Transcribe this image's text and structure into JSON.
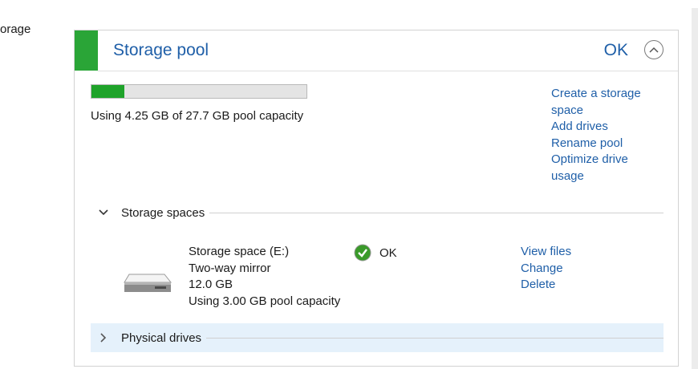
{
  "left_crumb": "orage",
  "panel": {
    "title": "Storage pool",
    "status": "OK",
    "accent_color": "#2aa537",
    "collapse_icon": "chevron-up-circle-icon"
  },
  "usage": {
    "fraction": 0.1534,
    "text": "Using 4.25 GB of 27.7 GB pool capacity"
  },
  "actions": {
    "create_space": "Create a storage space",
    "add_drives": "Add drives",
    "rename_pool": "Rename pool",
    "optimize": "Optimize drive usage"
  },
  "storage_spaces": {
    "label": "Storage spaces",
    "expanded": true,
    "items": [
      {
        "name": "Storage space (E:)",
        "resiliency": "Two-way mirror",
        "size": "12.0 GB",
        "usage": "Using 3.00 GB pool capacity",
        "status": "OK",
        "actions": {
          "view_files": "View files",
          "change": "Change",
          "delete": "Delete"
        }
      }
    ]
  },
  "physical_drives": {
    "label": "Physical drives",
    "expanded": false
  }
}
